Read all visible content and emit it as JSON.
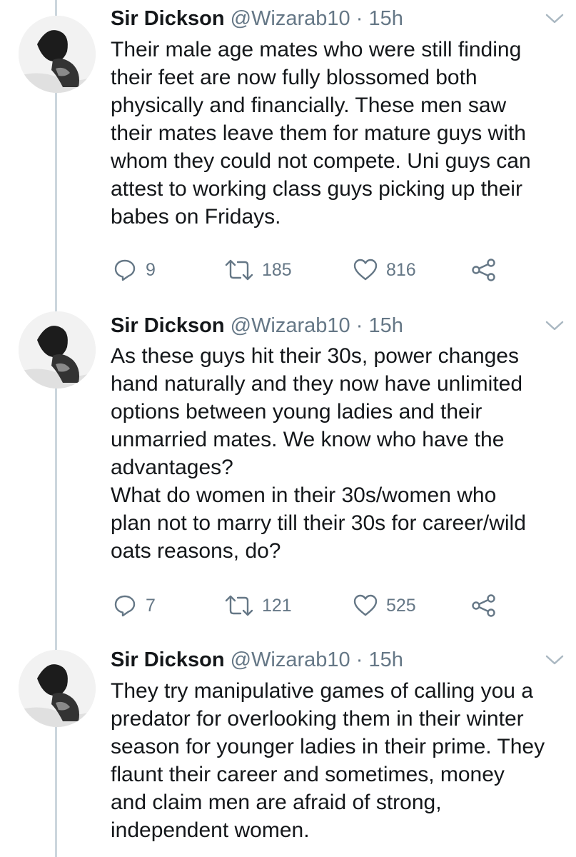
{
  "tweets": [
    {
      "name": "Sir Dickson",
      "handle": "@Wizarab10",
      "separator": "·",
      "time": "15h",
      "lines": [
        "Their male age mates who were still finding",
        "their feet are now fully blossomed both",
        "physically and financially. These men saw",
        "their mates leave them for mature guys with",
        "whom they could not compete. Uni guys can",
        "attest to working class guys picking up their",
        "babes on Fridays."
      ],
      "replies": "9",
      "retweets": "185",
      "likes": "816"
    },
    {
      "name": "Sir Dickson",
      "handle": "@Wizarab10",
      "separator": "·",
      "time": "15h",
      "lines": [
        "As these guys hit their 30s, power changes",
        "hand naturally and they now have unlimited",
        "options between young ladies and their",
        "unmarried mates. We know who have the",
        "advantages?",
        "What do women in their 30s/women who",
        "plan not to marry till their 30s for career/wild",
        "oats reasons, do?"
      ],
      "replies": "7",
      "retweets": "121",
      "likes": "525"
    },
    {
      "name": "Sir Dickson",
      "handle": "@Wizarab10",
      "separator": "·",
      "time": "15h",
      "lines": [
        "They try manipulative games of calling you a",
        "predator for overlooking them in their winter",
        "season for younger ladies in their prime. They",
        "flaunt their career and sometimes, money",
        "and claim men are afraid of strong,",
        "independent women."
      ]
    }
  ],
  "icons": {
    "reply": "reply-icon",
    "retweet": "retweet-icon",
    "like": "like-icon",
    "share": "share-icon",
    "menu": "chevron-down-icon",
    "avatar": "avatar"
  },
  "colors": {
    "name": "#14171a",
    "secondary": "#657786",
    "thread_line": "#ccd6dd",
    "background": "#ffffff"
  }
}
